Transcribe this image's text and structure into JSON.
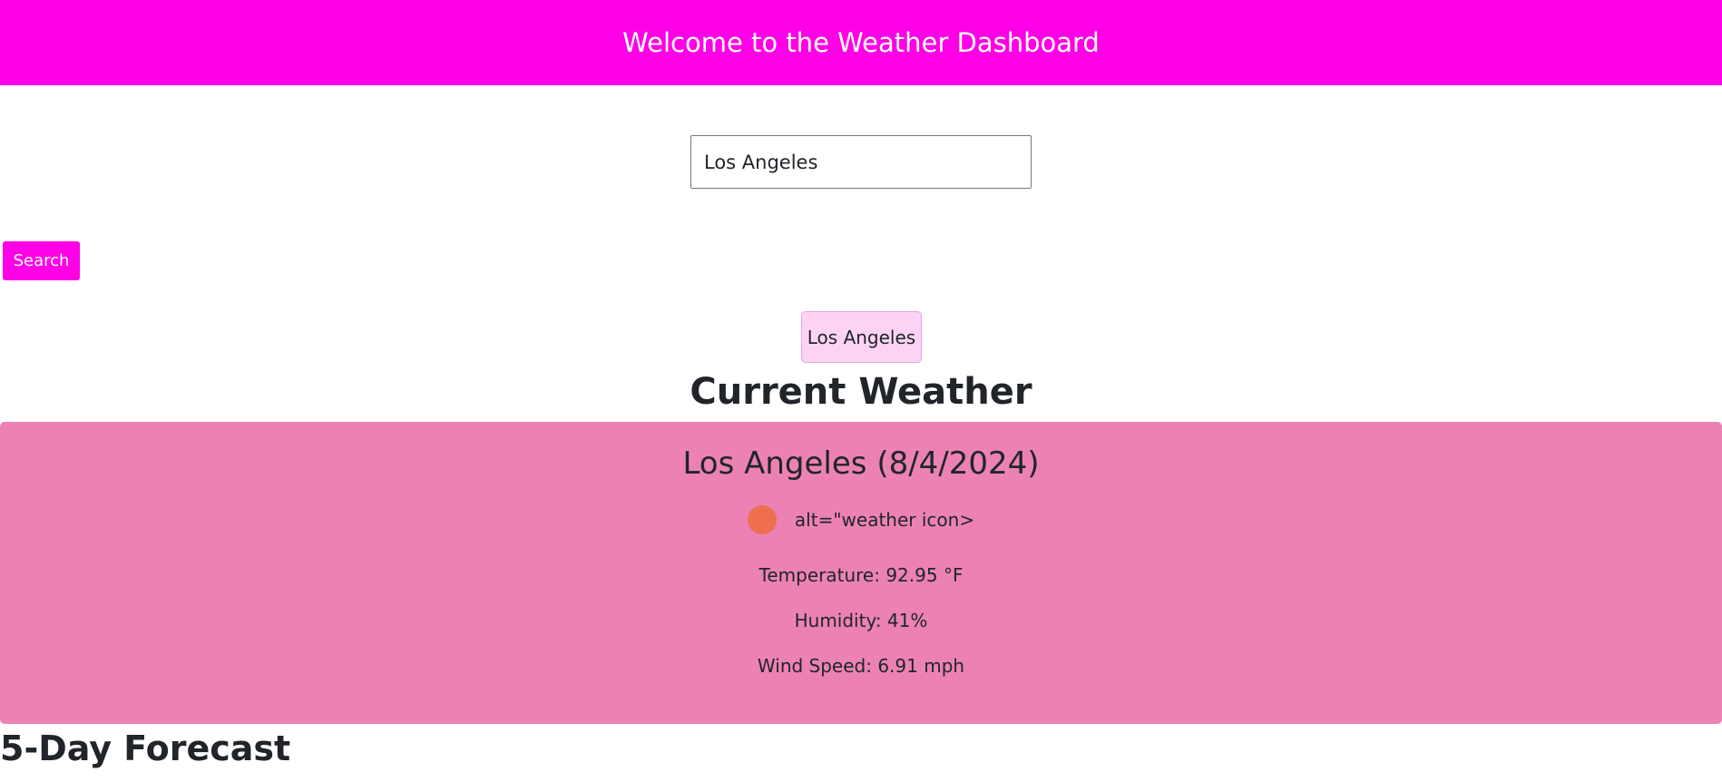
{
  "header": {
    "title": "Welcome to the Weather Dashboard"
  },
  "search": {
    "value": "Los Angeles",
    "button_label": "Search"
  },
  "history": {
    "items": [
      "Los Angeles"
    ]
  },
  "current": {
    "heading": "Current Weather",
    "card_title": "Los Angeles (8/4/2024)",
    "icon_alt_text": "alt=\"weather icon>",
    "temperature": "Temperature: 92.95 °F",
    "humidity": "Humidity: 41%",
    "wind": "Wind Speed: 6.91 mph"
  },
  "forecast": {
    "heading": "5-Day Forecast"
  },
  "colors": {
    "brand": "#ff00e6",
    "card_background": "#ec82b3",
    "history_button_background": "#fcd3f5",
    "icon_placeholder": "#ee6e4e"
  }
}
